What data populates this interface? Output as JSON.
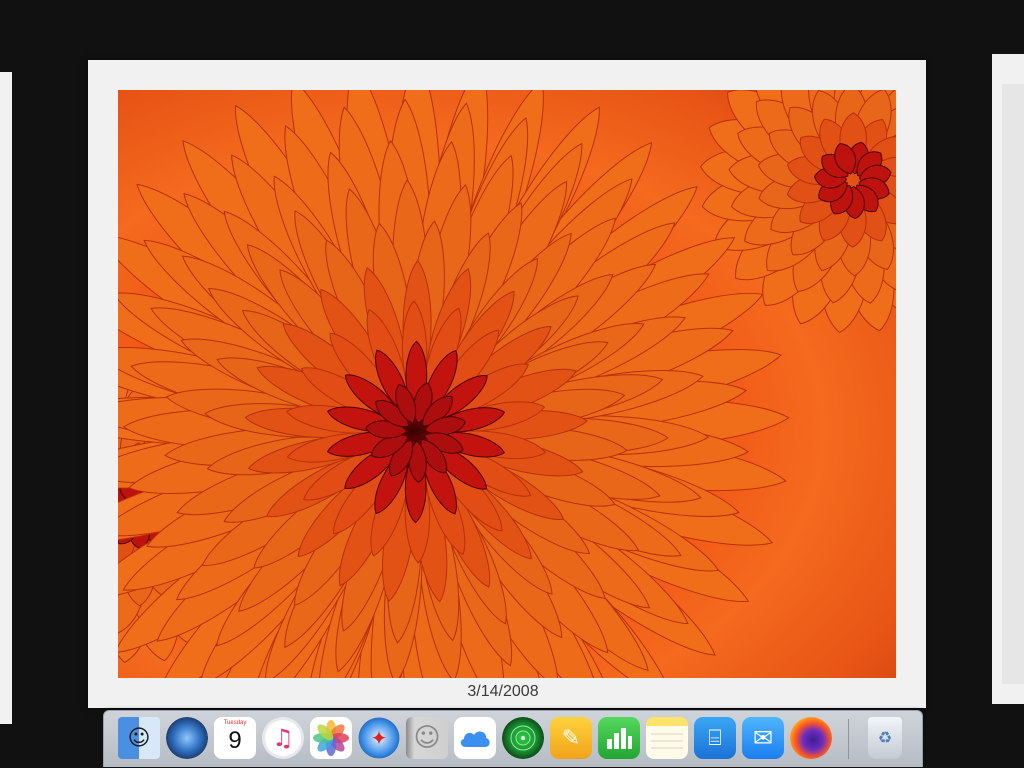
{
  "slideshow": {
    "caption": "3/14/2008"
  },
  "dock": {
    "items": [
      {
        "name": "Finder",
        "icon": "finder-icon"
      },
      {
        "name": "Launchpad",
        "icon": "launchpad-icon"
      },
      {
        "name": "Calendar",
        "icon": "calendar-icon",
        "day_label": "Tuesday",
        "day_number": "9"
      },
      {
        "name": "iTunes",
        "icon": "itunes-icon",
        "glyph": "♫"
      },
      {
        "name": "Photos",
        "icon": "photos-icon"
      },
      {
        "name": "Safari",
        "icon": "safari-icon",
        "glyph": "✦"
      },
      {
        "name": "Contacts",
        "icon": "contacts-icon",
        "glyph": "☺"
      },
      {
        "name": "iCloud Drive",
        "icon": "icloud-icon"
      },
      {
        "name": "Find My",
        "icon": "findmy-icon"
      },
      {
        "name": "Pages",
        "icon": "pages-icon",
        "glyph": "✎"
      },
      {
        "name": "Numbers",
        "icon": "numbers-icon"
      },
      {
        "name": "Notes",
        "icon": "notes-icon"
      },
      {
        "name": "Keynote",
        "icon": "keynote-icon",
        "glyph": "⌸"
      },
      {
        "name": "Mail",
        "icon": "mail-icon",
        "glyph": "✉"
      },
      {
        "name": "Firefox",
        "icon": "firefox-icon"
      },
      {
        "name": "Trash",
        "icon": "trash-icon",
        "glyph": "♻"
      }
    ]
  },
  "colors": {
    "background": "#111111",
    "slide_frame": "#f1f1f1",
    "flower_orange": "#f46a1e",
    "flower_center": "#7a0508"
  }
}
